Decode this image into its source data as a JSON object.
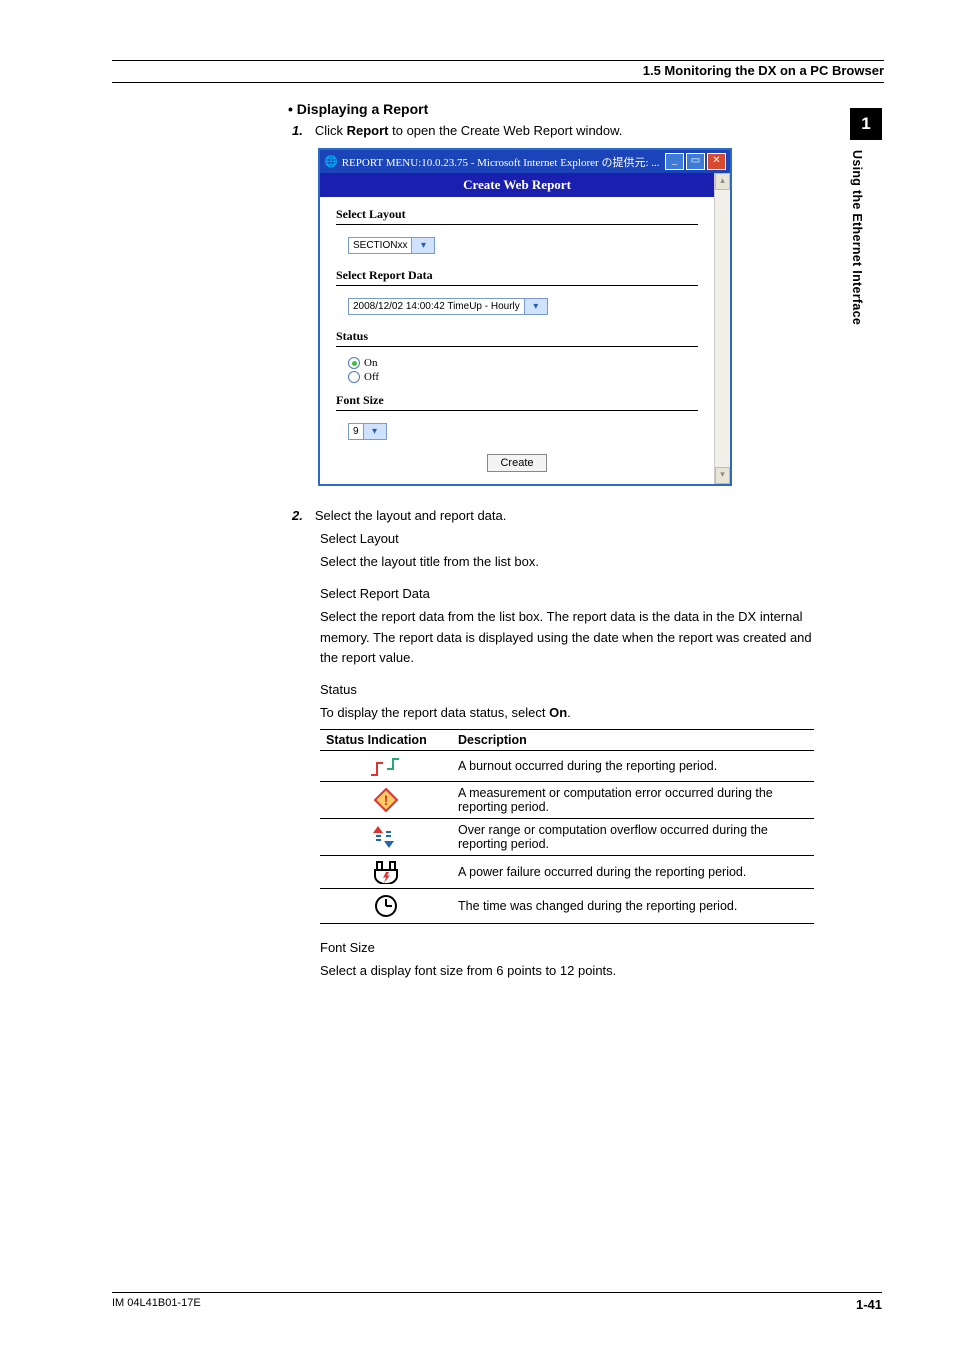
{
  "header": {
    "section_title": "1.5  Monitoring the DX on a PC Browser"
  },
  "side": {
    "chapter_num": "1",
    "chapter_title": "Using the Ethernet Interface"
  },
  "body": {
    "h_display": "Displaying a Report",
    "step1_num": "1.",
    "step1_txt_a": "Click ",
    "step1_txt_b": "Report",
    "step1_txt_c": " to open the Create Web Report window.",
    "step2_num": "2.",
    "step2_txt": "Select the layout and report data.",
    "p_sel_layout_h": "Select Layout",
    "p_sel_layout": "Select the layout title from the list box.",
    "p_sel_data_h": "Select Report Data",
    "p_sel_data": "Select the report data from the list box. The report data is the data in the DX internal memory. The report data is displayed using the date when the report was created and the report value.",
    "p_status_h": "Status",
    "p_status_a": "To display the report data status, select ",
    "p_status_b": "On",
    "p_status_c": ".",
    "p_font_h": "Font Size",
    "p_font": "Select a display font size from 6 points to 12 points."
  },
  "window": {
    "title": "REPORT MENU:10.0.23.75 - Microsoft Internet Explorer の提供元: ...",
    "header": "Create Web Report",
    "lbl_layout": "Select Layout",
    "opt_layout": "SECTIONxx",
    "lbl_data": "Select Report Data",
    "opt_data": "2008/12/02 14:00:42 TimeUp - Hourly",
    "lbl_status": "Status",
    "radio_on": "On",
    "radio_off": "Off",
    "lbl_font": "Font Size",
    "opt_font": "9",
    "btn_create": "Create"
  },
  "table": {
    "col1": "Status Indication",
    "col2": "Description",
    "rows": [
      "A burnout occurred during the reporting period.",
      "A measurement or computation error occurred during the reporting period.",
      "Over range or computation overflow occurred during the reporting period.",
      "A power failure occurred during the reporting period.",
      "The time was changed during the reporting period."
    ]
  },
  "footer": {
    "doc_id": "IM 04L41B01-17E",
    "page_num": "1-41"
  }
}
